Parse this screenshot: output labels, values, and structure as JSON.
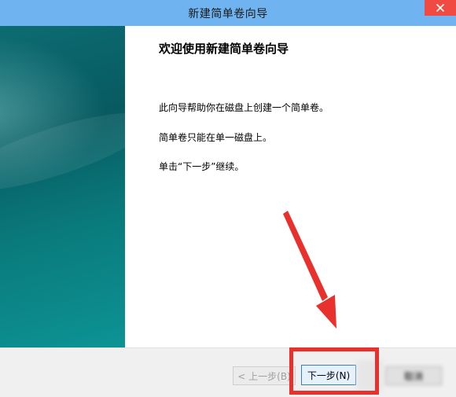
{
  "window": {
    "title": "新建简单卷向导"
  },
  "welcome": {
    "heading": "欢迎使用新建简单卷向导",
    "line1": "此向导帮助你在磁盘上创建一个简单卷。",
    "line2": "简单卷只能在单一磁盘上。",
    "line3": "单击“下一步”继续。"
  },
  "buttons": {
    "back_label": "< 上一步(B)",
    "next_label": "下一步(N)",
    "cancel_label": "取消"
  },
  "annotation": {
    "color": "#e8312d"
  },
  "icons": {
    "close": "close-icon",
    "annotation_arrow": "arrow-icon"
  }
}
